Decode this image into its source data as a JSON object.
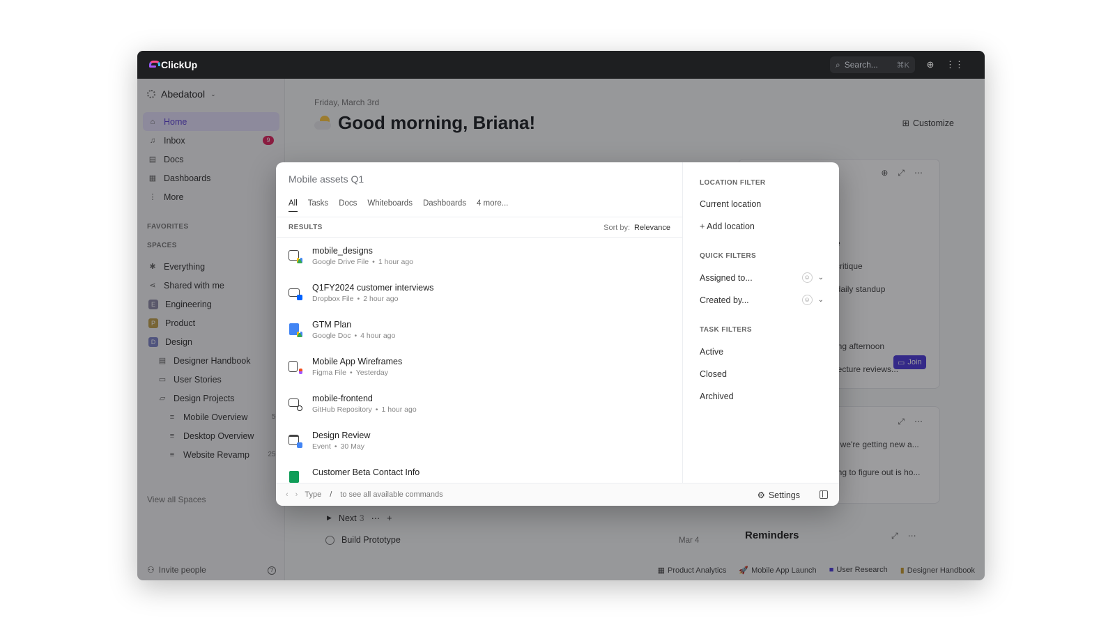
{
  "app": {
    "name": "ClickUp"
  },
  "topbar": {
    "search_placeholder": "Search...",
    "search_shortcut": "⌘K"
  },
  "sidebar": {
    "workspace": "Abedatool",
    "nav": [
      {
        "label": "Home",
        "icon": "home-icon"
      },
      {
        "label": "Inbox",
        "icon": "bell-icon",
        "badge": "9"
      },
      {
        "label": "Docs",
        "icon": "doc-icon"
      },
      {
        "label": "Dashboards",
        "icon": "dashboard-icon"
      },
      {
        "label": "More",
        "icon": "more-icon"
      }
    ],
    "favorites_label": "FAVORITES",
    "spaces_label": "SPACES",
    "spaces": [
      {
        "label": "Everything"
      },
      {
        "label": "Shared with me"
      },
      {
        "label": "Engineering",
        "badge": "E",
        "color": "#8e8ba8"
      },
      {
        "label": "Product",
        "badge": "P",
        "color": "#c2a04a"
      },
      {
        "label": "Design",
        "badge": "D",
        "color": "#7c84c9"
      },
      {
        "label": "Designer Handbook"
      },
      {
        "label": "User Stories"
      },
      {
        "label": "Design Projects"
      },
      {
        "label": "Mobile Overview",
        "count": "56"
      },
      {
        "label": "Desktop Overview",
        "count": "8"
      },
      {
        "label": "Website Revamp",
        "count": "256"
      }
    ],
    "view_all": "View all Spaces",
    "invite": "Invite people"
  },
  "main": {
    "date": "Friday, March 3rd",
    "greeting": "Good morning, Briana!",
    "customize": "Customize",
    "peek_text": [
      "me",
      "n critique",
      "A daily standup",
      "nc",
      "eting afternoon",
      "hitecture reviews...",
      "en we're getting new a...",
      "thing to figure out is ho..."
    ],
    "join": "Join",
    "next_label": "Next",
    "next_count": "3",
    "task": "Build Prototype",
    "task_date": "Mar 4",
    "reminders": "Reminders",
    "footer_links": [
      "Product Analytics",
      "Mobile App Launch",
      "User Research",
      "Designer Handbook"
    ]
  },
  "modal": {
    "query": "Mobile assets Q1",
    "tabs": [
      "All",
      "Tasks",
      "Docs",
      "Whiteboards",
      "Dashboards",
      "4 more..."
    ],
    "results_label": "RESULTS",
    "sort_label": "Sort by:",
    "sort_value": "Relevance",
    "results": [
      {
        "title": "mobile_designs",
        "source": "Google Drive File",
        "time": "1 hour ago"
      },
      {
        "title": "Q1FY2024 customer interviews",
        "source": "Dropbox File",
        "time": "2 hour ago"
      },
      {
        "title": "GTM Plan",
        "source": "Google Doc",
        "time": "4 hour ago"
      },
      {
        "title": "Mobile App Wireframes",
        "source": "Figma File",
        "time": "Yesterday"
      },
      {
        "title": "mobile-frontend",
        "source": "GitHub Repository",
        "time": "1 hour ago"
      },
      {
        "title": "Design Review",
        "source": "Event",
        "time": "30 May"
      },
      {
        "title": "Customer Beta Contact Info",
        "source": "",
        "time": ""
      }
    ],
    "footer": {
      "type": "Type",
      "slash": "/",
      "hint": "to see all available commands",
      "settings": "Settings"
    },
    "filters": {
      "location_label": "LOCATION FILTER",
      "current_location": "Current location",
      "add_location": "+ Add location",
      "quick_label": "QUICK FILTERS",
      "assigned": "Assigned to...",
      "created": "Created by...",
      "task_label": "TASK FILTERS",
      "active": "Active",
      "closed": "Closed",
      "archived": "Archived"
    }
  }
}
